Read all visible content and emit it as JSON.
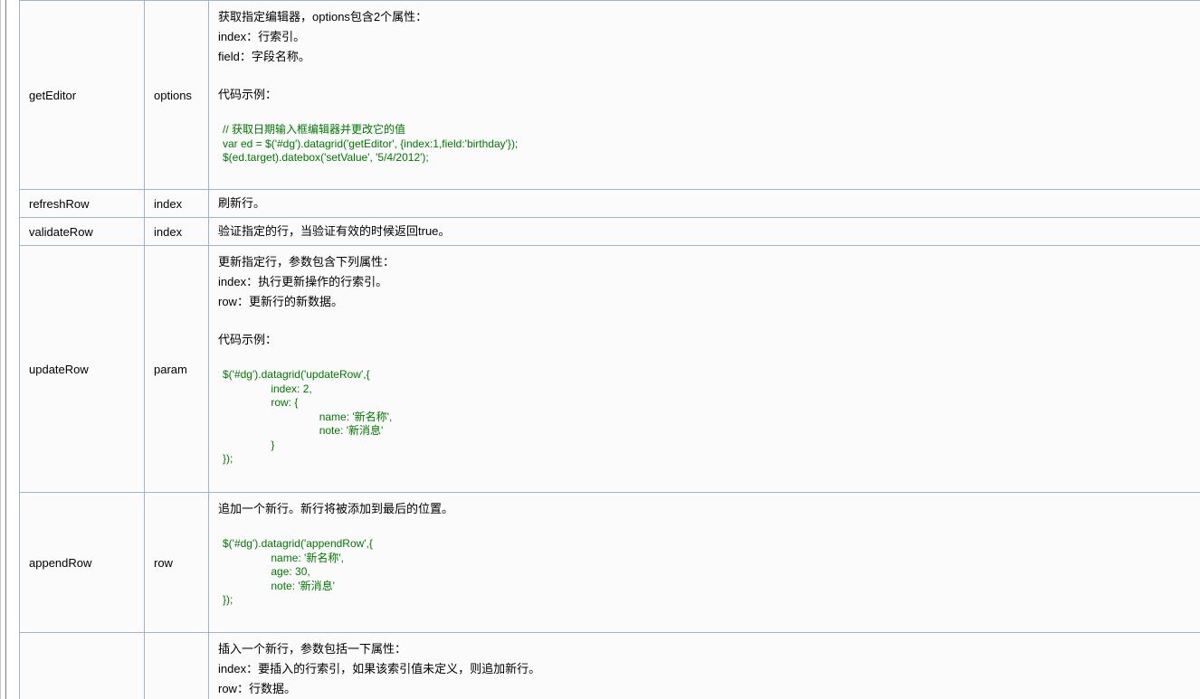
{
  "rows": [
    {
      "name": "getEditor",
      "param": "options",
      "desc_lines": [
        "获取指定编辑器，options包含2个属性：",
        "index：行索引。",
        "field：字段名称。",
        "",
        "代码示例："
      ],
      "code": "// 获取日期输入框编辑器并更改它的值\nvar ed = $('#dg').datagrid('getEditor', {index:1,field:'birthday'});\n$(ed.target).datebox('setValue', '5/4/2012');"
    },
    {
      "name": "refreshRow",
      "param": "index",
      "desc_lines": [
        "刷新行。"
      ]
    },
    {
      "name": "validateRow",
      "param": "index",
      "desc_lines": [
        "验证指定的行，当验证有效的时候返回true。"
      ]
    },
    {
      "name": "updateRow",
      "param": "param",
      "desc_lines": [
        "更新指定行，参数包含下列属性：",
        "index：执行更新操作的行索引。",
        "row：更新行的新数据。",
        "",
        "代码示例："
      ],
      "code": "$('#dg').datagrid('updateRow',{\n\t\tindex: 2,\n\t\trow: {\n\t\t\t\tname: '新名称',\n\t\t\t\tnote: '新消息'\n\t\t}\n});"
    },
    {
      "name": "appendRow",
      "param": "row",
      "desc_lines": [
        "追加一个新行。新行将被添加到最后的位置。"
      ],
      "code": "$('#dg').datagrid('appendRow',{\n\t\tname: '新名称',\n\t\tage: 30,\n\t\tnote: '新消息'\n});"
    },
    {
      "name": "",
      "param": "",
      "desc_lines": [
        "插入一个新行，参数包括一下属性：",
        "index：要插入的行索引，如果该索引值未定义，则追加新行。",
        "row：行数据。"
      ]
    }
  ]
}
